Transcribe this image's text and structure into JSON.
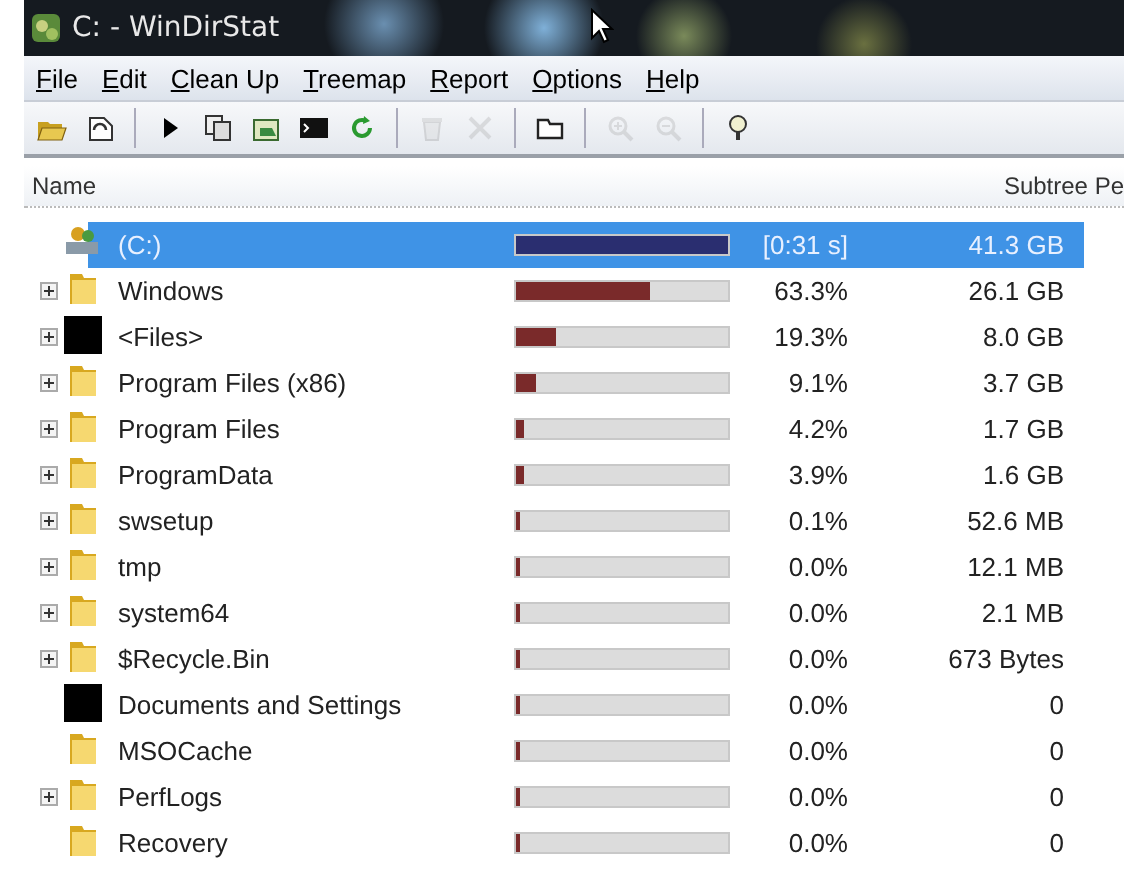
{
  "window": {
    "title": "C: - WinDirStat"
  },
  "menu": [
    {
      "label": "File"
    },
    {
      "label": "Edit"
    },
    {
      "label": "Clean Up"
    },
    {
      "label": "Treemap"
    },
    {
      "label": "Report"
    },
    {
      "label": "Options"
    },
    {
      "label": "Help"
    }
  ],
  "toolbar": [
    {
      "kind": "open",
      "disabled": false
    },
    {
      "kind": "rescan",
      "disabled": false
    },
    {
      "kind": "separator"
    },
    {
      "kind": "play",
      "disabled": false
    },
    {
      "kind": "copy",
      "disabled": false
    },
    {
      "kind": "explorer",
      "disabled": false
    },
    {
      "kind": "prompt",
      "disabled": false
    },
    {
      "kind": "refresh",
      "disabled": false
    },
    {
      "kind": "separator"
    },
    {
      "kind": "recycle",
      "disabled": true
    },
    {
      "kind": "delete",
      "disabled": true
    },
    {
      "kind": "separator"
    },
    {
      "kind": "folder",
      "disabled": false
    },
    {
      "kind": "separator"
    },
    {
      "kind": "zoom-in",
      "disabled": true
    },
    {
      "kind": "zoom-out",
      "disabled": true
    },
    {
      "kind": "separator"
    },
    {
      "kind": "help",
      "disabled": false
    }
  ],
  "table": {
    "columns": [
      {
        "label": "Name"
      },
      {
        "label": "Subtree Pe"
      }
    ],
    "rows": [
      {
        "name": "(C:)",
        "kind": "drive",
        "expandable": false,
        "level": 1,
        "percent": "[0:31 s]",
        "size": "41.3 GB",
        "selected": true
      },
      {
        "name": "Windows",
        "kind": "folder",
        "expandable": true,
        "level": 0.633,
        "percent": "63.3%",
        "size": "26.1 GB",
        "selected": false
      },
      {
        "name": "<Files>",
        "kind": "files",
        "expandable": true,
        "level": 0.193,
        "percent": "19.3%",
        "size": "8.0 GB",
        "selected": false
      },
      {
        "name": "Program Files (x86)",
        "kind": "folder",
        "expandable": true,
        "level": 0.091,
        "percent": "9.1%",
        "size": "3.7 GB",
        "selected": false
      },
      {
        "name": "Program Files",
        "kind": "folder",
        "expandable": true,
        "level": 0.042,
        "percent": "4.2%",
        "size": "1.7 GB",
        "selected": false
      },
      {
        "name": "ProgramData",
        "kind": "folder",
        "expandable": true,
        "level": 0.039,
        "percent": "3.9%",
        "size": "1.6 GB",
        "selected": false
      },
      {
        "name": "swsetup",
        "kind": "folder",
        "expandable": true,
        "level": 0.001,
        "percent": "0.1%",
        "size": "52.6 MB",
        "selected": false
      },
      {
        "name": "tmp",
        "kind": "folder",
        "expandable": true,
        "level": 0,
        "percent": "0.0%",
        "size": "12.1 MB",
        "selected": false
      },
      {
        "name": "system64",
        "kind": "folder",
        "expandable": true,
        "level": 0,
        "percent": "0.0%",
        "size": "2.1 MB",
        "selected": false
      },
      {
        "name": "$Recycle.Bin",
        "kind": "folder",
        "expandable": true,
        "level": 0,
        "percent": "0.0%",
        "size": "673 Bytes",
        "selected": false
      },
      {
        "name": "Documents and Settings",
        "kind": "files",
        "expandable": false,
        "level": 0,
        "percent": "0.0%",
        "size": "0",
        "selected": false
      },
      {
        "name": "MSOCache",
        "kind": "folder",
        "expandable": false,
        "level": 0,
        "percent": "0.0%",
        "size": "0",
        "selected": false
      },
      {
        "name": "PerfLogs",
        "kind": "folder",
        "expandable": true,
        "level": 0,
        "percent": "0.0%",
        "size": "0",
        "selected": false
      },
      {
        "name": "Recovery",
        "kind": "folder",
        "expandable": false,
        "level": 0,
        "percent": "0.0%",
        "size": "0",
        "selected": false
      }
    ]
  }
}
